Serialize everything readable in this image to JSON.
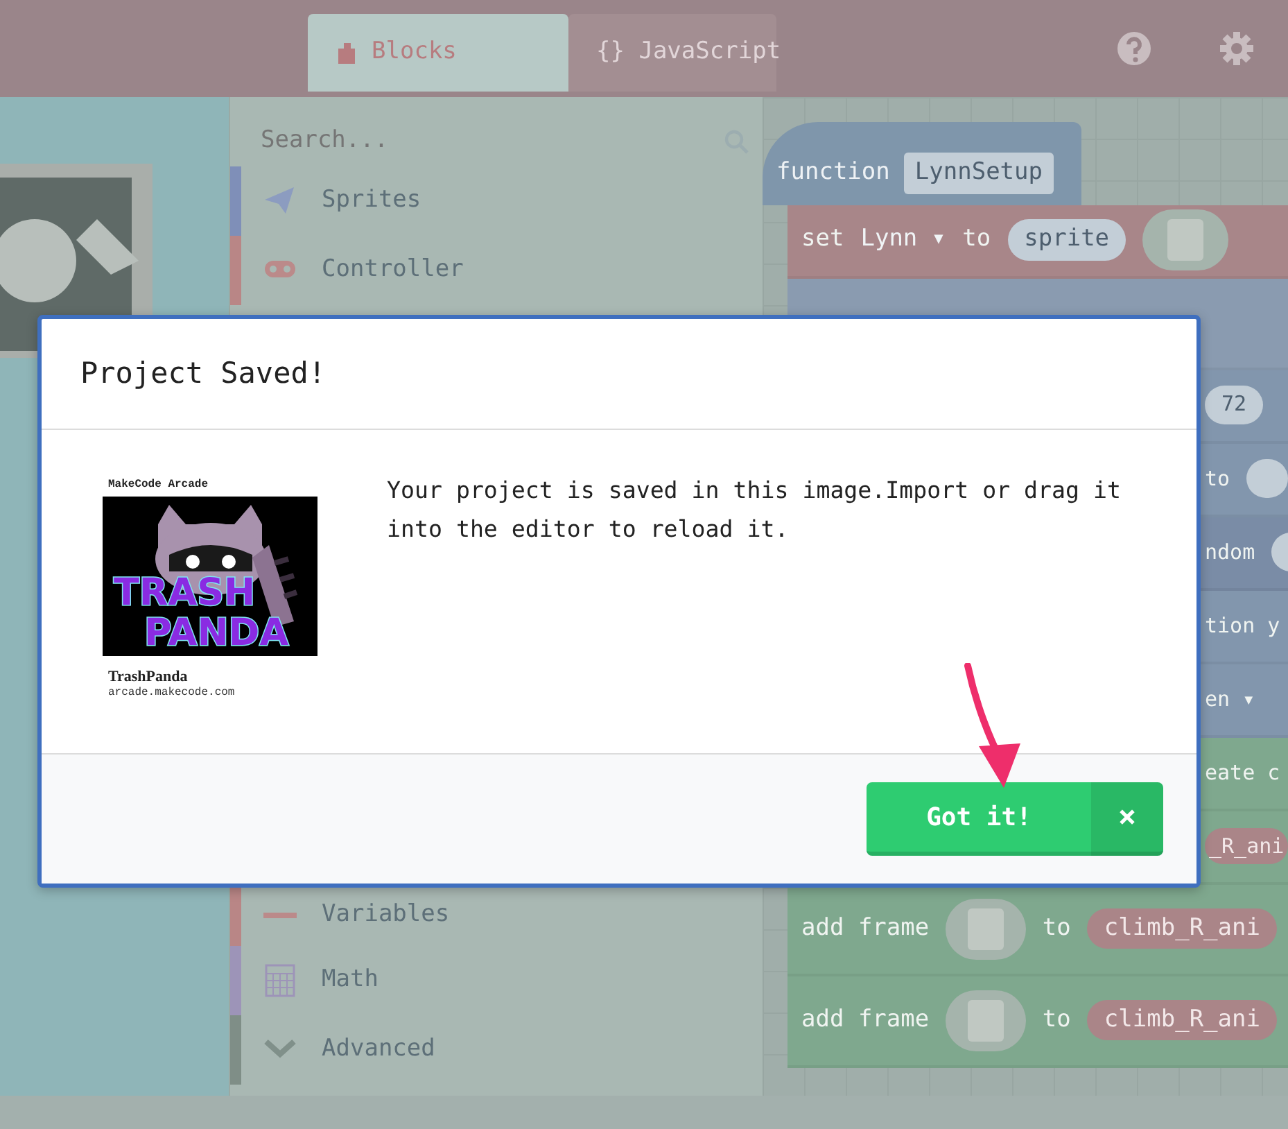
{
  "header": {
    "tabs": [
      {
        "label": "Blocks",
        "selected": true
      },
      {
        "label": "{} JavaScript",
        "selected": false
      }
    ]
  },
  "toolbox": {
    "search": {
      "placeholder": "Search..."
    },
    "categories": [
      {
        "kind": "sprites",
        "label": "Sprites",
        "color": "#7f8fb8"
      },
      {
        "kind": "controller",
        "label": "Controller",
        "color": "#b98686"
      },
      {
        "kind": "variables",
        "label": "Variables",
        "color": "#b98686"
      },
      {
        "kind": "math",
        "label": "Math",
        "color": "#9d94b8"
      },
      {
        "kind": "advanced",
        "label": "Advanced",
        "color": "#7f8e87"
      }
    ]
  },
  "workspace": {
    "function_block": {
      "keyword": "function",
      "name": "LynnSetup"
    },
    "statements": [
      {
        "color": "#a88689",
        "parts": [
          {
            "kind": "word",
            "text": "set"
          },
          {
            "kind": "dropdown",
            "text": "Lynn ▾"
          },
          {
            "kind": "word",
            "text": "to"
          },
          {
            "kind": "pill",
            "text": "sprite"
          },
          {
            "kind": "image"
          }
        ]
      },
      {
        "color": "#8a9bb0"
      },
      {
        "color": "#8296ad",
        "parts": [
          {
            "kind": "pill",
            "text": "72"
          }
        ]
      },
      {
        "color": "#8296ad",
        "parts": [
          {
            "kind": "word",
            "text": "to"
          },
          {
            "kind": "pill"
          }
        ]
      },
      {
        "color": "#7a8ca6",
        "parts": [
          {
            "kind": "word",
            "text": "ndom"
          },
          {
            "kind": "pill"
          }
        ]
      },
      {
        "color": "#8296ad",
        "parts": [
          {
            "kind": "word",
            "text": "tion y"
          }
        ]
      },
      {
        "color": "#8296ad",
        "parts": [
          {
            "kind": "word",
            "text": "en ▾"
          }
        ]
      },
      {
        "color": "#7fa88e",
        "parts": [
          {
            "kind": "word",
            "text": "eate c"
          }
        ]
      },
      {
        "color": "#7fa88e",
        "parts": [
          {
            "kind": "tag",
            "text": "_R_ani"
          }
        ]
      },
      {
        "color": "#7fa88e",
        "parts": [
          {
            "kind": "word",
            "text": "add frame"
          },
          {
            "kind": "image"
          },
          {
            "kind": "word",
            "text": "to"
          },
          {
            "kind": "tag",
            "text": "climb_R_ani"
          }
        ]
      },
      {
        "color": "#7fa88e",
        "parts": [
          {
            "kind": "word",
            "text": "add frame"
          },
          {
            "kind": "image"
          },
          {
            "kind": "word",
            "text": "to"
          },
          {
            "kind": "tag",
            "text": "climb_R_ani"
          }
        ]
      }
    ]
  },
  "dialog": {
    "title": "Project Saved!",
    "card": {
      "caption": "MakeCode Arcade",
      "art_lines": [
        "TRASH",
        "PANDA"
      ],
      "name": "TrashPanda",
      "url": "arcade.makecode.com"
    },
    "message": "Your project is saved in this image.Import or drag it into the editor to reload it.",
    "buttons": [
      {
        "kind": "confirm",
        "label": "Got it!"
      },
      {
        "kind": "close",
        "label": "×"
      }
    ]
  }
}
